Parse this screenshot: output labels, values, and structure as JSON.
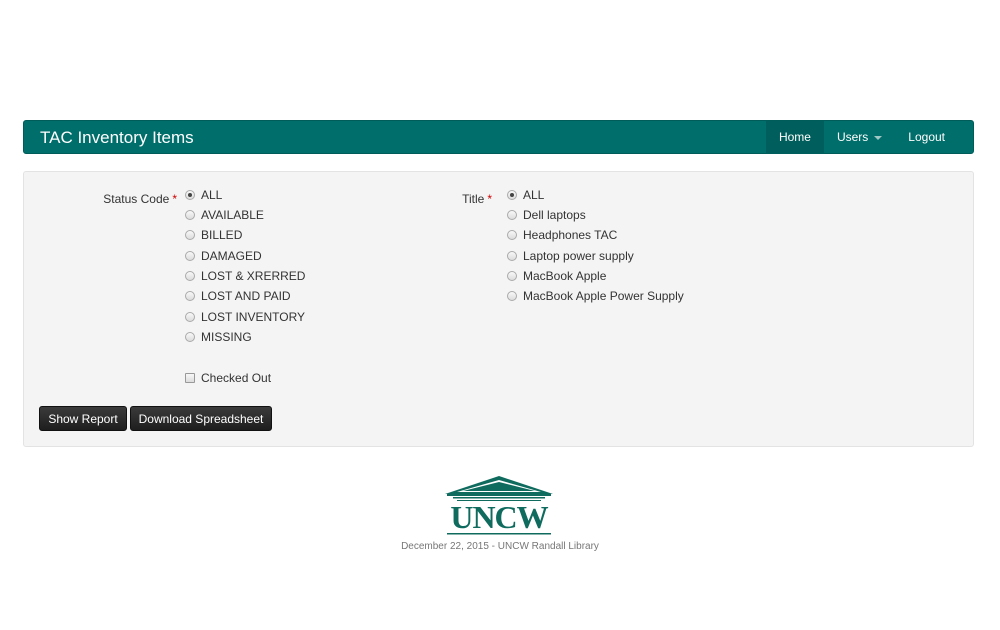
{
  "header": {
    "brand": "TAC Inventory Items",
    "nav": [
      {
        "label": "Home"
      },
      {
        "label": "Users"
      },
      {
        "label": "Logout"
      }
    ]
  },
  "form": {
    "status_code": {
      "label": "Status Code",
      "required_mark": "*",
      "options": [
        "ALL",
        "AVAILABLE",
        "BILLED",
        "DAMAGED",
        "LOST & XRERRED",
        "LOST AND PAID",
        "LOST INVENTORY",
        "MISSING"
      ],
      "selected": "ALL"
    },
    "checked_out": {
      "label": "Checked Out",
      "checked": false
    },
    "title": {
      "label": "Title",
      "required_mark": "*",
      "options": [
        "ALL",
        "Dell laptops",
        "Headphones TAC",
        "Laptop power supply",
        "MacBook Apple",
        "MacBook Apple Power Supply"
      ],
      "selected": "ALL"
    },
    "buttons": {
      "show_report": "Show Report",
      "download_spreadsheet": "Download Spreadsheet"
    }
  },
  "footer": {
    "logo_text": "UNCW",
    "text": "December 22, 2015 - UNCW Randall Library"
  },
  "colors": {
    "navbar": "#006e6b",
    "logo": "#0f6b5e",
    "required": "#cc0000",
    "button": "#2a2a2a"
  }
}
